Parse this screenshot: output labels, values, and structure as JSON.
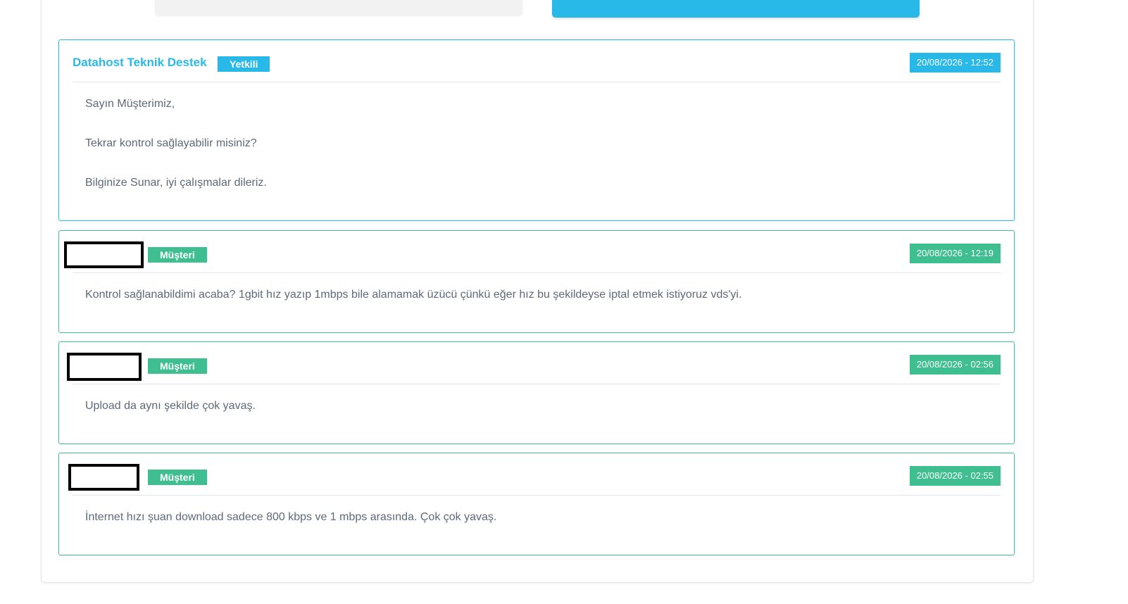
{
  "messages": [
    {
      "author": "Datahost Teknik Destek",
      "role": "Yetkili",
      "date": "20/08/2026 - 12:52",
      "lines": [
        "Sayın Müşterimiz,",
        "Tekrar kontrol sağlayabilir misiniz?",
        "Bilginize Sunar, iyi çalışmalar dileriz."
      ]
    },
    {
      "author": "",
      "role": "Müşteri",
      "date": "20/08/2026 - 12:19",
      "lines": [
        "Kontrol sağlanabildimi acaba? 1gbit hız yazıp 1mbps bile alamamak üzücü çünkü eğer hız bu şekildeyse iptal etmek istiyoruz vds'yi."
      ]
    },
    {
      "author": "",
      "role": "Müşteri",
      "date": "20/08/2026 - 02:56",
      "lines": [
        "Upload da aynı şekilde çok yavaş."
      ]
    },
    {
      "author": "",
      "role": "Müşteri",
      "date": "20/08/2026 - 02:55",
      "lines": [
        "İnternet hızı şuan download sadece 800 kbps ve 1 mbps arasında. Çok çok yavaş."
      ]
    }
  ],
  "colors": {
    "staff_accent": "#29b9e8",
    "client_accent": "#3fbf8f"
  }
}
